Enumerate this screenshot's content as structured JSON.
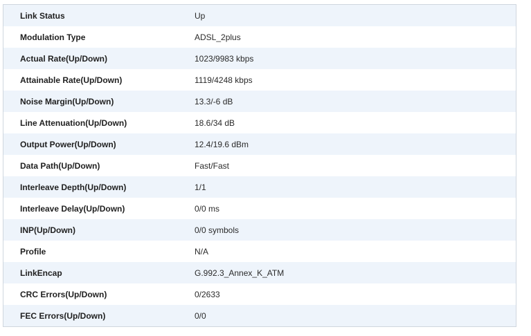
{
  "rows": [
    {
      "label": "Link Status",
      "value": "Up"
    },
    {
      "label": "Modulation Type",
      "value": "ADSL_2plus"
    },
    {
      "label": "Actual Rate(Up/Down)",
      "value": "1023/9983 kbps"
    },
    {
      "label": "Attainable Rate(Up/Down)",
      "value": "1119/4248 kbps"
    },
    {
      "label": "Noise Margin(Up/Down)",
      "value": "13.3/-6 dB"
    },
    {
      "label": "Line Attenuation(Up/Down)",
      "value": "18.6/34 dB"
    },
    {
      "label": "Output Power(Up/Down)",
      "value": "12.4/19.6 dBm"
    },
    {
      "label": "Data Path(Up/Down)",
      "value": "Fast/Fast"
    },
    {
      "label": "Interleave Depth(Up/Down)",
      "value": "1/1"
    },
    {
      "label": "Interleave Delay(Up/Down)",
      "value": "0/0 ms"
    },
    {
      "label": "INP(Up/Down)",
      "value": "0/0 symbols"
    },
    {
      "label": "Profile",
      "value": "N/A"
    },
    {
      "label": "LinkEncap",
      "value": "G.992.3_Annex_K_ATM"
    },
    {
      "label": "CRC Errors(Up/Down)",
      "value": "0/2633"
    },
    {
      "label": "FEC Errors(Up/Down)",
      "value": "0/0"
    }
  ]
}
